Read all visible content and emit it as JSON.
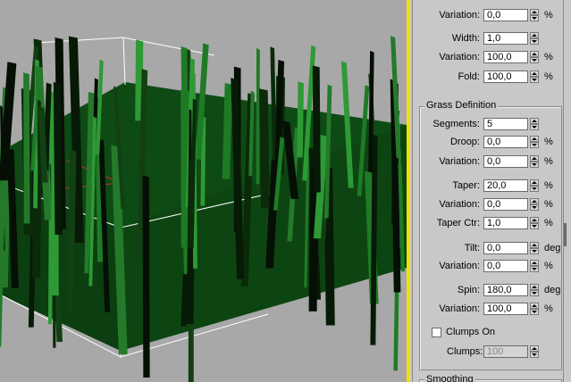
{
  "viewport": {
    "ground_color": "#0e4a14",
    "background_color": "#a8a8a8"
  },
  "panel": {
    "accent_border": "#f5e000",
    "rows_top": [
      {
        "label": "Variation:",
        "value": "0,0",
        "unit": "%"
      },
      {
        "label": "Width:",
        "value": "1,0",
        "unit": ""
      },
      {
        "label": "Variation:",
        "value": "100,0",
        "unit": "%"
      },
      {
        "label": "Fold:",
        "value": "100,0",
        "unit": "%"
      }
    ],
    "grass_definition": {
      "title": "Grass Definition",
      "rows": [
        {
          "label": "Segments:",
          "value": "5",
          "unit": ""
        },
        {
          "label": "Droop:",
          "value": "0,0",
          "unit": "%"
        },
        {
          "label": "Variation:",
          "value": "0,0",
          "unit": "%"
        },
        {
          "label": "Taper:",
          "value": "20,0",
          "unit": "%"
        },
        {
          "label": "Variation:",
          "value": "0,0",
          "unit": "%"
        },
        {
          "label": "Taper Ctr:",
          "value": "1,0",
          "unit": "%"
        },
        {
          "label": "Tilt:",
          "value": "0,0",
          "unit": "deg"
        },
        {
          "label": "Variation:",
          "value": "0,0",
          "unit": "%"
        },
        {
          "label": "Spin:",
          "value": "180,0",
          "unit": "deg"
        },
        {
          "label": "Variation:",
          "value": "100,0",
          "unit": "%"
        }
      ],
      "clumps_on_label": "Clumps On",
      "clumps_on_checked": false,
      "clumps_label": "Clumps:",
      "clumps_value": "100"
    },
    "smoothing_title": "Smoothing"
  }
}
